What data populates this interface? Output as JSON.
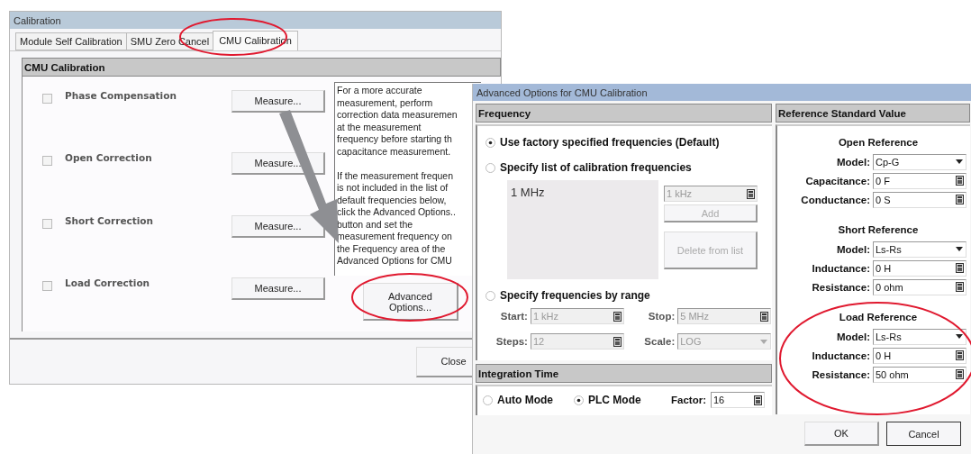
{
  "calibration_window": {
    "title": "Calibration",
    "tabs": [
      {
        "label": "Module Self Calibration",
        "selected": false
      },
      {
        "label": "SMU Zero Cancel",
        "selected": false
      },
      {
        "label": "CMU Calibration",
        "selected": true
      }
    ],
    "group_title": "CMU Calibration",
    "items": [
      {
        "label": "Phase Compensation",
        "checked": false,
        "button": "Measure..."
      },
      {
        "label": "Open Correction",
        "checked": false,
        "button": "Measure..."
      },
      {
        "label": "Short Correction",
        "checked": false,
        "button": "Measure..."
      },
      {
        "label": "Load Correction",
        "checked": false,
        "button": "Measure..."
      }
    ],
    "help_text_paragraphs": [
      [
        "For a more accurate",
        "measurement, perform",
        "correction data measuremen",
        "at the measurement",
        "frequency before starting th",
        "capacitance measurement."
      ],
      [
        "If the measurement frequen",
        "is not included in the list of",
        "default frequencies below,",
        "click the Advanced Options..",
        "button and set the",
        "measurement frequency on",
        "the Frequency area of the",
        "Advanced Options for CMU"
      ]
    ],
    "advanced_button": "Advanced Options...",
    "close_button": "Close"
  },
  "advanced_dialog": {
    "title": "Advanced Options for CMU Calibration",
    "frequency": {
      "title": "Frequency",
      "options": [
        {
          "label": "Use factory specified frequencies (Default)",
          "selected": true
        },
        {
          "label": "Specify list of calibration frequencies",
          "selected": false
        },
        {
          "label": "Specify frequencies by range",
          "selected": false
        }
      ],
      "list_items": [
        "1 MHz"
      ],
      "add_field": {
        "value": "1 kHz",
        "disabled": true
      },
      "add_button": {
        "label": "Add",
        "disabled": true
      },
      "delete_button": {
        "label": "Delete from list",
        "disabled": true
      },
      "range_fields": [
        {
          "label": "Start:",
          "value": "1 kHz",
          "kind": "calc",
          "disabled": true
        },
        {
          "label": "Stop:",
          "value": "5 MHz",
          "kind": "calc",
          "disabled": true
        },
        {
          "label": "Steps:",
          "value": "12",
          "kind": "calc",
          "disabled": true
        },
        {
          "label": "Scale:",
          "value": "LOG",
          "kind": "dropdown",
          "disabled": true
        }
      ]
    },
    "integration": {
      "title": "Integration Time",
      "modes": [
        {
          "label": "Auto Mode",
          "selected": false
        },
        {
          "label": "PLC Mode",
          "selected": true
        }
      ],
      "factor": {
        "label": "Factor:",
        "value": "16",
        "kind": "calc",
        "disabled": false
      }
    },
    "reference": {
      "title": "Reference Standard Value",
      "sections": [
        {
          "title": "Open Reference",
          "fields": [
            {
              "label": "Model:",
              "value": "Cp-G",
              "kind": "dropdown",
              "disabled": false
            },
            {
              "label": "Capacitance:",
              "value": "0 F",
              "kind": "calc",
              "disabled": false
            },
            {
              "label": "Conductance:",
              "value": "0 S",
              "kind": "calc",
              "disabled": false
            }
          ]
        },
        {
          "title": "Short Reference",
          "fields": [
            {
              "label": "Model:",
              "value": "Ls-Rs",
              "kind": "dropdown",
              "disabled": false
            },
            {
              "label": "Inductance:",
              "value": "0 H",
              "kind": "calc",
              "disabled": false
            },
            {
              "label": "Resistance:",
              "value": "0 ohm",
              "kind": "calc",
              "disabled": false
            }
          ]
        },
        {
          "title": "Load Reference",
          "fields": [
            {
              "label": "Model:",
              "value": "Ls-Rs",
              "kind": "dropdown",
              "disabled": false
            },
            {
              "label": "Inductance:",
              "value": "0 H",
              "kind": "calc",
              "disabled": false
            },
            {
              "label": "Resistance:",
              "value": "50 ohm",
              "kind": "calc",
              "disabled": false
            }
          ]
        }
      ]
    },
    "buttons": [
      "OK",
      "Cancel"
    ]
  }
}
